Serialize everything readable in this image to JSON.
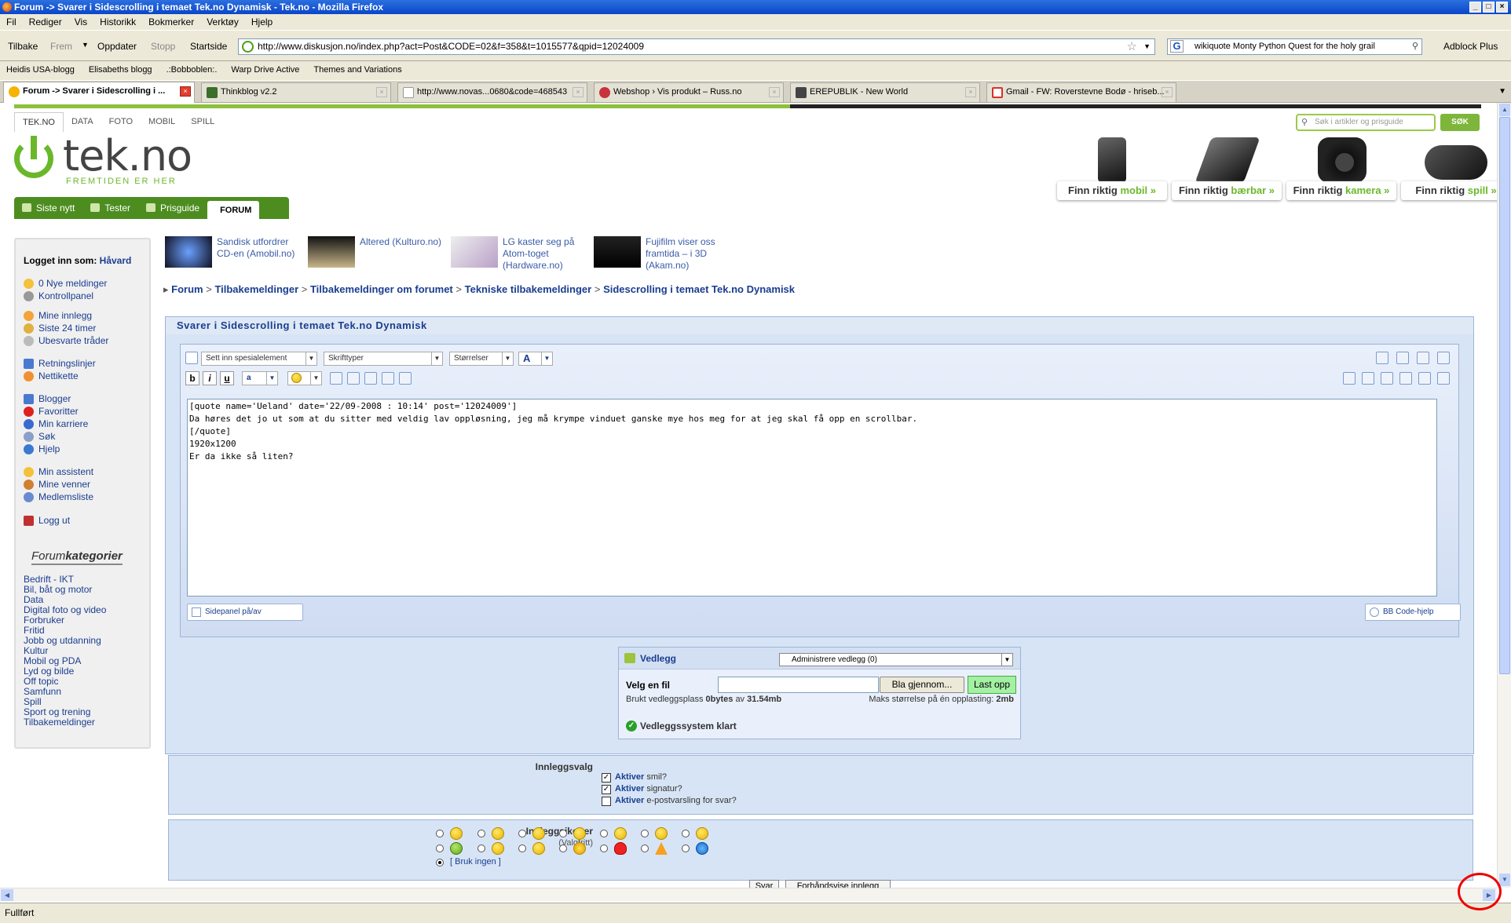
{
  "window": {
    "title": "Forum -> Svarer i Sidescrolling i temaet Tek.no Dynamisk - Tek.no - Mozilla Firefox",
    "controls": [
      "_",
      "□",
      "×"
    ]
  },
  "menu": [
    "Fil",
    "Rediger",
    "Vis",
    "Historikk",
    "Bokmerker",
    "Verktøy",
    "Hjelp"
  ],
  "toolbar": {
    "back": "Tilbake",
    "forward": "Frem",
    "reload": "Oppdater",
    "stop": "Stopp",
    "home": "Startside",
    "url": "http://www.diskusjon.no/index.php?act=Post&CODE=02&f=358&t=1015577&qpid=12024009",
    "search_value": "wikiquote Monty Python Quest for the holy grail",
    "adblock": "Adblock Plus"
  },
  "bookmarks": [
    "Heidis USA-blogg",
    "Elisabeths blogg",
    ".:Bobboblen:.",
    "Warp Drive Active",
    "Themes and Variations"
  ],
  "tabs": [
    {
      "label": "Forum -> Svarer i Sidescrolling i ...",
      "active": true,
      "color": "#f5b400"
    },
    {
      "label": "Thinkblog v2.2",
      "active": false,
      "color": "#3a6e2a"
    },
    {
      "label": "http://www.novas...0680&code=468543",
      "active": false,
      "color": "#cccccc"
    },
    {
      "label": "Webshop › Vis produkt – Russ.no",
      "active": false,
      "color": "#c8323c"
    },
    {
      "label": "EREPUBLIK - New World",
      "active": false,
      "color": "#444444"
    },
    {
      "label": "Gmail - FW: Roverstevne Bodø - hriseb...",
      "active": false,
      "color": "#d93025"
    }
  ],
  "status": "Fullført",
  "site": {
    "topnav": [
      "TEK.NO",
      "DATA",
      "FOTO",
      "MOBIL",
      "SPILL"
    ],
    "search_placeholder": "Søk i artikler og prisguide",
    "search_button": "SØK",
    "logo_name": "tek.no",
    "logo_tagline": "FREMTIDEN ER HER",
    "promos": [
      {
        "pre": "Finn riktig",
        "word": "mobil »"
      },
      {
        "pre": "Finn riktig",
        "word": "bærbar »"
      },
      {
        "pre": "Finn riktig",
        "word": "kamera »"
      },
      {
        "pre": "Finn riktig",
        "word": "spill »"
      }
    ],
    "mainnav": [
      "Siste nytt",
      "Tester",
      "Prisguide",
      "FORUM"
    ],
    "accent": "#6ab82a"
  },
  "sidebar": {
    "logged_in_label": "Logget inn som:",
    "user": "Håvard",
    "groups": [
      [
        {
          "label": "0 Nye meldinger",
          "icon": "mail-icon"
        },
        {
          "label": "Kontrollpanel",
          "icon": "tools-icon"
        }
      ],
      [
        {
          "label": "Mine innlegg",
          "icon": "posts-icon"
        },
        {
          "label": "Siste 24 timer",
          "icon": "clock-icon"
        },
        {
          "label": "Ubesvarte tråder",
          "icon": "threads-icon"
        }
      ],
      [
        {
          "label": "Retningslinjer",
          "icon": "rules-icon"
        },
        {
          "label": "Nettikette",
          "icon": "etiquette-icon"
        }
      ],
      [
        {
          "label": "Blogger",
          "icon": "blog-icon"
        },
        {
          "label": "Favoritter",
          "icon": "heart-icon"
        },
        {
          "label": "Min karriere",
          "icon": "career-icon"
        },
        {
          "label": "Søk",
          "icon": "search-icon"
        },
        {
          "label": "Hjelp",
          "icon": "help-icon"
        }
      ],
      [
        {
          "label": "Min assistent",
          "icon": "assistant-icon"
        },
        {
          "label": "Mine venner",
          "icon": "friends-icon"
        },
        {
          "label": "Medlemsliste",
          "icon": "members-icon"
        }
      ],
      [
        {
          "label": "Logg ut",
          "icon": "logout-icon"
        }
      ]
    ],
    "categories_title_a": "Forum",
    "categories_title_b": "kategorier",
    "categories": [
      "Bedrift - IKT",
      "Bil, båt og motor",
      "Data",
      "Digital foto og video",
      "Forbruker",
      "Fritid",
      "Jobb og utdanning",
      "Kultur",
      "Mobil og PDA",
      "Lyd og bilde",
      "Off topic",
      "Samfunn",
      "Spill",
      "Sport og trening",
      "Tilbakemeldinger"
    ]
  },
  "news": [
    {
      "lines": [
        "Sandisk utfordrer",
        "CD-en (Amobil.no)"
      ]
    },
    {
      "lines": [
        "Altered (Kulturo.no)"
      ]
    },
    {
      "lines": [
        "LG kaster seg på",
        "Atom-toget",
        "(Hardware.no)"
      ]
    },
    {
      "lines": [
        "Fujifilm viser oss",
        "framtida – i 3D",
        "(Akam.no)"
      ]
    }
  ],
  "breadcrumb": [
    "Forum",
    "Tilbakemeldinger",
    "Tilbakemeldinger om forumet",
    "Tekniske tilbakemeldinger",
    "Sidescrolling i temaet Tek.no Dynamisk"
  ],
  "reply": {
    "title": "Svarer i Sidescrolling i temaet Tek.no Dynamisk",
    "special_select": "Sett inn spesialelement",
    "font_select": "Skrifttyper",
    "size_select": "Størrelser",
    "color_select": "A",
    "format_buttons": [
      "b",
      "i",
      "u"
    ],
    "body": "[quote name='Ueland' date='22/09-2008 : 10:14' post='12024009']\nDa høres det jo ut som at du sitter med veldig lav oppløsning, jeg må krympe vinduet ganske mye hos meg for at jeg skal få opp en scrollbar.\n[/quote]\n1920x1200\nEr da ikke så liten?",
    "sidepanel": "Sidepanel på/av",
    "bbcode_help": "BB Code-hjelp"
  },
  "attach": {
    "title": "Vedlegg",
    "manage": "Administrere vedlegg (0)",
    "choose_file": "Velg en fil",
    "browse": "Bla gjennom...",
    "upload": "Last opp",
    "used_pre": "Brukt vedleggsplass",
    "used_val": "0bytes",
    "used_mid": "av",
    "used_total": "31.54mb",
    "max_pre": "Maks størrelse på én opplasting:",
    "max_val": "2mb",
    "ready": "Vedleggssystem klart"
  },
  "options": {
    "label": "Innleggsvalg",
    "items": [
      {
        "bold": "Aktiver",
        "rest": "smil?",
        "checked": true
      },
      {
        "bold": "Aktiver",
        "rest": "signatur?",
        "checked": true
      },
      {
        "bold": "Aktiver",
        "rest": "e-postvarsling for svar?",
        "checked": false
      }
    ]
  },
  "icons": {
    "label": "Innleggsikoner",
    "sublabel": "(Valgfritt)",
    "none": "[ Bruk ingen ]"
  },
  "submit": {
    "reply": "Svar",
    "preview": "Forhåndsvise innlegg"
  }
}
